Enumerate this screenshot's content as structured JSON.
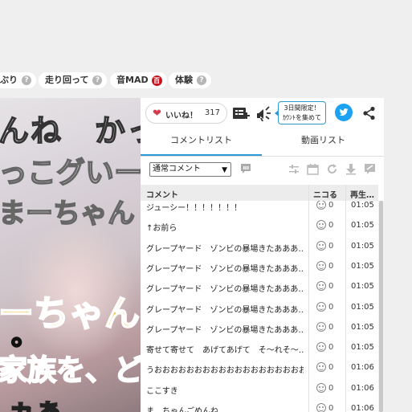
{
  "tags": [
    {
      "label": "ぶり",
      "badge": null
    },
    {
      "label": "走り回って",
      "badge": null
    },
    {
      "label": "音MAD",
      "badge": "百"
    },
    {
      "label": "体験",
      "badge": null
    }
  ],
  "tag_help_glyph": "?",
  "video": {
    "lines": [
      "んね　かっこ",
      "っこグいー",
      "まーちゃん",
      "ーちゃん",
      "。",
      "家族を、ど",
      "ヵぁ"
    ]
  },
  "panel": {
    "like": {
      "label": "いいね！",
      "count": "317"
    },
    "promo": {
      "line1": "3日間限定！",
      "line2": "ｶｳﾝﾄを集めて"
    },
    "tabs": [
      {
        "label": "コメントリスト",
        "active": true
      },
      {
        "label": "動画リスト",
        "active": false
      }
    ],
    "filter": {
      "selected": "通常コメント"
    },
    "columns": {
      "comment": "コメント",
      "nicoru": "ニコる",
      "time": "再生…"
    },
    "rows": [
      {
        "text": "ジューシー！！！！！！！",
        "count": "0",
        "time": "01:05"
      },
      {
        "text": "↑お前ら",
        "count": "0",
        "time": "01:05"
      },
      {
        "text": "グレープヤード　ゾンビの暴場きたあああ…",
        "count": "0",
        "time": "01:05"
      },
      {
        "text": "グレープヤード　ゾンビの暴場きたあああ…",
        "count": "0",
        "time": "01:05"
      },
      {
        "text": "グレープヤード　ゾンビの暴場きたあああ…",
        "count": "0",
        "time": "01:05"
      },
      {
        "text": "グレープヤード　ゾンビの暴場きたあああ…",
        "count": "0",
        "time": "01:05"
      },
      {
        "text": "グレープヤード　ゾンビの暴場きたあああ…",
        "count": "0",
        "time": "01:05"
      },
      {
        "text": "寄せて寄せて　あげてあげて　そ〜れそ〜…",
        "count": "0",
        "time": "01:05"
      },
      {
        "text": "うおおおおおおおおおおおおおおおおおおお…",
        "count": "0",
        "time": "01:06"
      },
      {
        "text": "ここすき",
        "count": "0",
        "time": "01:06"
      },
      {
        "text": "ま　ちゃんごめんね",
        "count": "0",
        "time": "01:06"
      }
    ]
  },
  "colors": {
    "accent": "#2a9ad8",
    "twitter": "#1da1f2",
    "heart": "#d63a4b",
    "tag_badge": "#c7131d"
  }
}
